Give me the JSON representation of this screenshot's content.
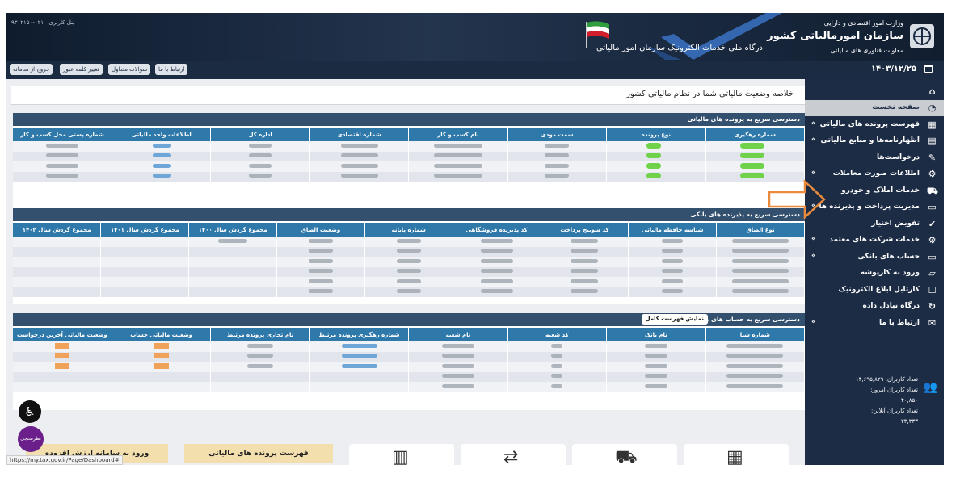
{
  "header": {
    "ministry": "وزارت امور اقتصادی و دارایی",
    "org_name": "سازمان امورمالیاتی کشور",
    "deputy": "معاونت فناوری های مالیاتی",
    "portal": "درگاه ملی خدمات الکترونیک سازمان امور مالیاتی",
    "top_left_items": [
      "پنل کاربری",
      "۰۲۱-۹۳۰۲۱۵۰"
    ]
  },
  "toolbar": {
    "contact": "ارتباط با ما",
    "faq": "سوالات متداول",
    "change_password": "تغییر کلمه عبور",
    "logout": "خروج از سامانه",
    "date": "۱۴۰۳/۱۲/۲۵"
  },
  "page_title": "خلاصه وضعیت مالیاتی شما در نظام مالیاتی کشور",
  "sidebar": {
    "items": [
      {
        "label": "صفحه نخست",
        "icon": "dashboard-icon",
        "active": true,
        "has_submenu": false
      },
      {
        "label": "فهرست پرونده های مالیاتی",
        "icon": "building-icon",
        "active": false,
        "has_submenu": true
      },
      {
        "label": "اظهارنامه‌ها و منابع مالیاتی",
        "icon": "document-icon",
        "active": false,
        "has_submenu": true
      },
      {
        "label": "درخواست‌ها",
        "icon": "request-icon",
        "active": false,
        "has_submenu": false
      },
      {
        "label": "اطلاعات صورت معاملات",
        "icon": "gear-icon",
        "active": false,
        "has_submenu": true
      },
      {
        "label": "خدمات املاک و خودرو",
        "icon": "car-icon",
        "active": false,
        "has_submenu": false
      },
      {
        "label": "مدیریت پرداخت و پذیرنده ها",
        "icon": "card-icon",
        "active": false,
        "has_submenu": true
      },
      {
        "label": "تفویض اختیار",
        "icon": "delegate-icon",
        "active": false,
        "has_submenu": false
      },
      {
        "label": "خدمات شرکت های معتمد",
        "icon": "trusted-icon",
        "active": false,
        "has_submenu": true
      },
      {
        "label": "حساب های بانکی",
        "icon": "bank-card-icon",
        "active": false,
        "has_submenu": true
      },
      {
        "label": "ورود به کارپوشه",
        "icon": "folder-icon",
        "active": false,
        "has_submenu": false
      },
      {
        "label": "کارتابل ابلاغ الکترونیک",
        "icon": "inbox-icon",
        "active": false,
        "has_submenu": false
      },
      {
        "label": "درگاه تبادل داده",
        "icon": "exchange-icon",
        "active": false,
        "has_submenu": false
      },
      {
        "label": "ارتباط با ما",
        "icon": "mail-icon",
        "active": false,
        "has_submenu": true
      }
    ],
    "stats": [
      "تعداد کاربران: ۱۴,۶۹۵,۸۲۹",
      "تعداد کاربران امروز: ۴۰,۸۵۰",
      "تعداد کاربران آنلاین: ۲۳,۳۳۳"
    ]
  },
  "panel1": {
    "title": "دسترسی سریع به پرونده های مالیاتی",
    "columns": [
      "شماره رهگیری",
      "نوع پرونده",
      "سمت مودی",
      "نام کسب و کار",
      "شماره اقتصادی",
      "اداره کل",
      "اطلاعات واحد مالیاتی",
      "شماره پستی محل کسب و کار"
    ],
    "rows": [
      [
        "",
        "",
        "",
        "",
        "",
        "",
        "",
        ""
      ],
      [
        "",
        "",
        "",
        "",
        "",
        "",
        "",
        ""
      ],
      [
        "",
        "",
        "",
        "",
        "",
        "",
        "",
        ""
      ],
      [
        "",
        "",
        "",
        "",
        "",
        "",
        "",
        ""
      ]
    ]
  },
  "panel2": {
    "title": "دسترسی سریع به پذیرنده های بانکی",
    "columns": [
      "نوع الصاق",
      "شناسه حافظه مالیاتی",
      "کد سوییچ پرداخت",
      "کد پذیرنده فروشگاهی",
      "شماره پایانه",
      "وضعیت الصاق",
      "مجموع گردش سال ۱۴۰۰",
      "مجموع گردش سال ۱۴۰۱",
      "مجموع گردش سال ۱۴۰۲"
    ],
    "rows": 6
  },
  "panel3": {
    "title": "دسترسی سریع به حساب های بانکی",
    "button": "نمایش فهرست کامل",
    "columns": [
      "شماره شبا",
      "نام بانک",
      "کد شعبه",
      "نام شعبه",
      "شماره رهگیری پرونده مرتبط",
      "نام تجاری پرونده مرتبط",
      "وضعیت مالیاتی حساب",
      "وضعیت مالیاتی آخرین درخواست"
    ],
    "rows": 5
  },
  "bottom": {
    "yellow_boxes": [
      "ورود به سامانه ارزش افزوده",
      "فهرست پرونده های مالیاتی"
    ],
    "cards": [
      "building-icon",
      "car-icon",
      "car-service-icon",
      "exchange-car-icon"
    ]
  },
  "widgets": {
    "vote": "نظرسنجی",
    "status_url": "https://my.tax.gov.ir/Page/Dashboard#"
  },
  "colors": {
    "header_bg": "#1a2a40",
    "sidebar_bg": "#1c2c45",
    "table_header": "#2f78aa",
    "panel_header": "#34506f",
    "highlight_arrow": "#e98a3c"
  }
}
